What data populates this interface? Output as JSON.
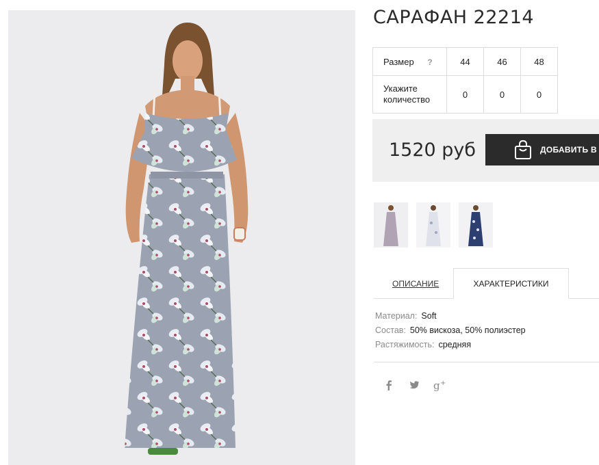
{
  "product": {
    "title": "САРАФАН 22214",
    "price": "1520 руб",
    "add_to_cart_label": "ДОБАВИТЬ В КОРЗИНУ"
  },
  "size_table": {
    "size_label": "Размер",
    "help_mark": "?",
    "quantity_label": "Укажите количество",
    "sizes": [
      "44",
      "46",
      "48"
    ],
    "quantities": [
      "0",
      "0",
      "0"
    ]
  },
  "thumbnails": [
    {
      "name": "thumb-grey-floral"
    },
    {
      "name": "thumb-white-floral"
    },
    {
      "name": "thumb-navy-floral"
    }
  ],
  "tabs": {
    "description": "ОПИСАНИЕ",
    "characteristics": "ХАРАКТЕРИСТИКИ"
  },
  "specs": [
    {
      "key": "Материал:",
      "value": "Soft"
    },
    {
      "key": "Состав:",
      "value": "50% вискоза, 50% полиэстер"
    },
    {
      "key": "Растяжимость:",
      "value": "средняя"
    }
  ],
  "social": [
    "facebook-icon",
    "twitter-icon",
    "google-plus-icon"
  ],
  "colors": {
    "button_bg": "#2b2b2b",
    "price_box_bg": "#efefef",
    "photo_bg": "#ececef",
    "dress_grey": "#9aa1b0",
    "dress_navy": "#2c3f70"
  }
}
